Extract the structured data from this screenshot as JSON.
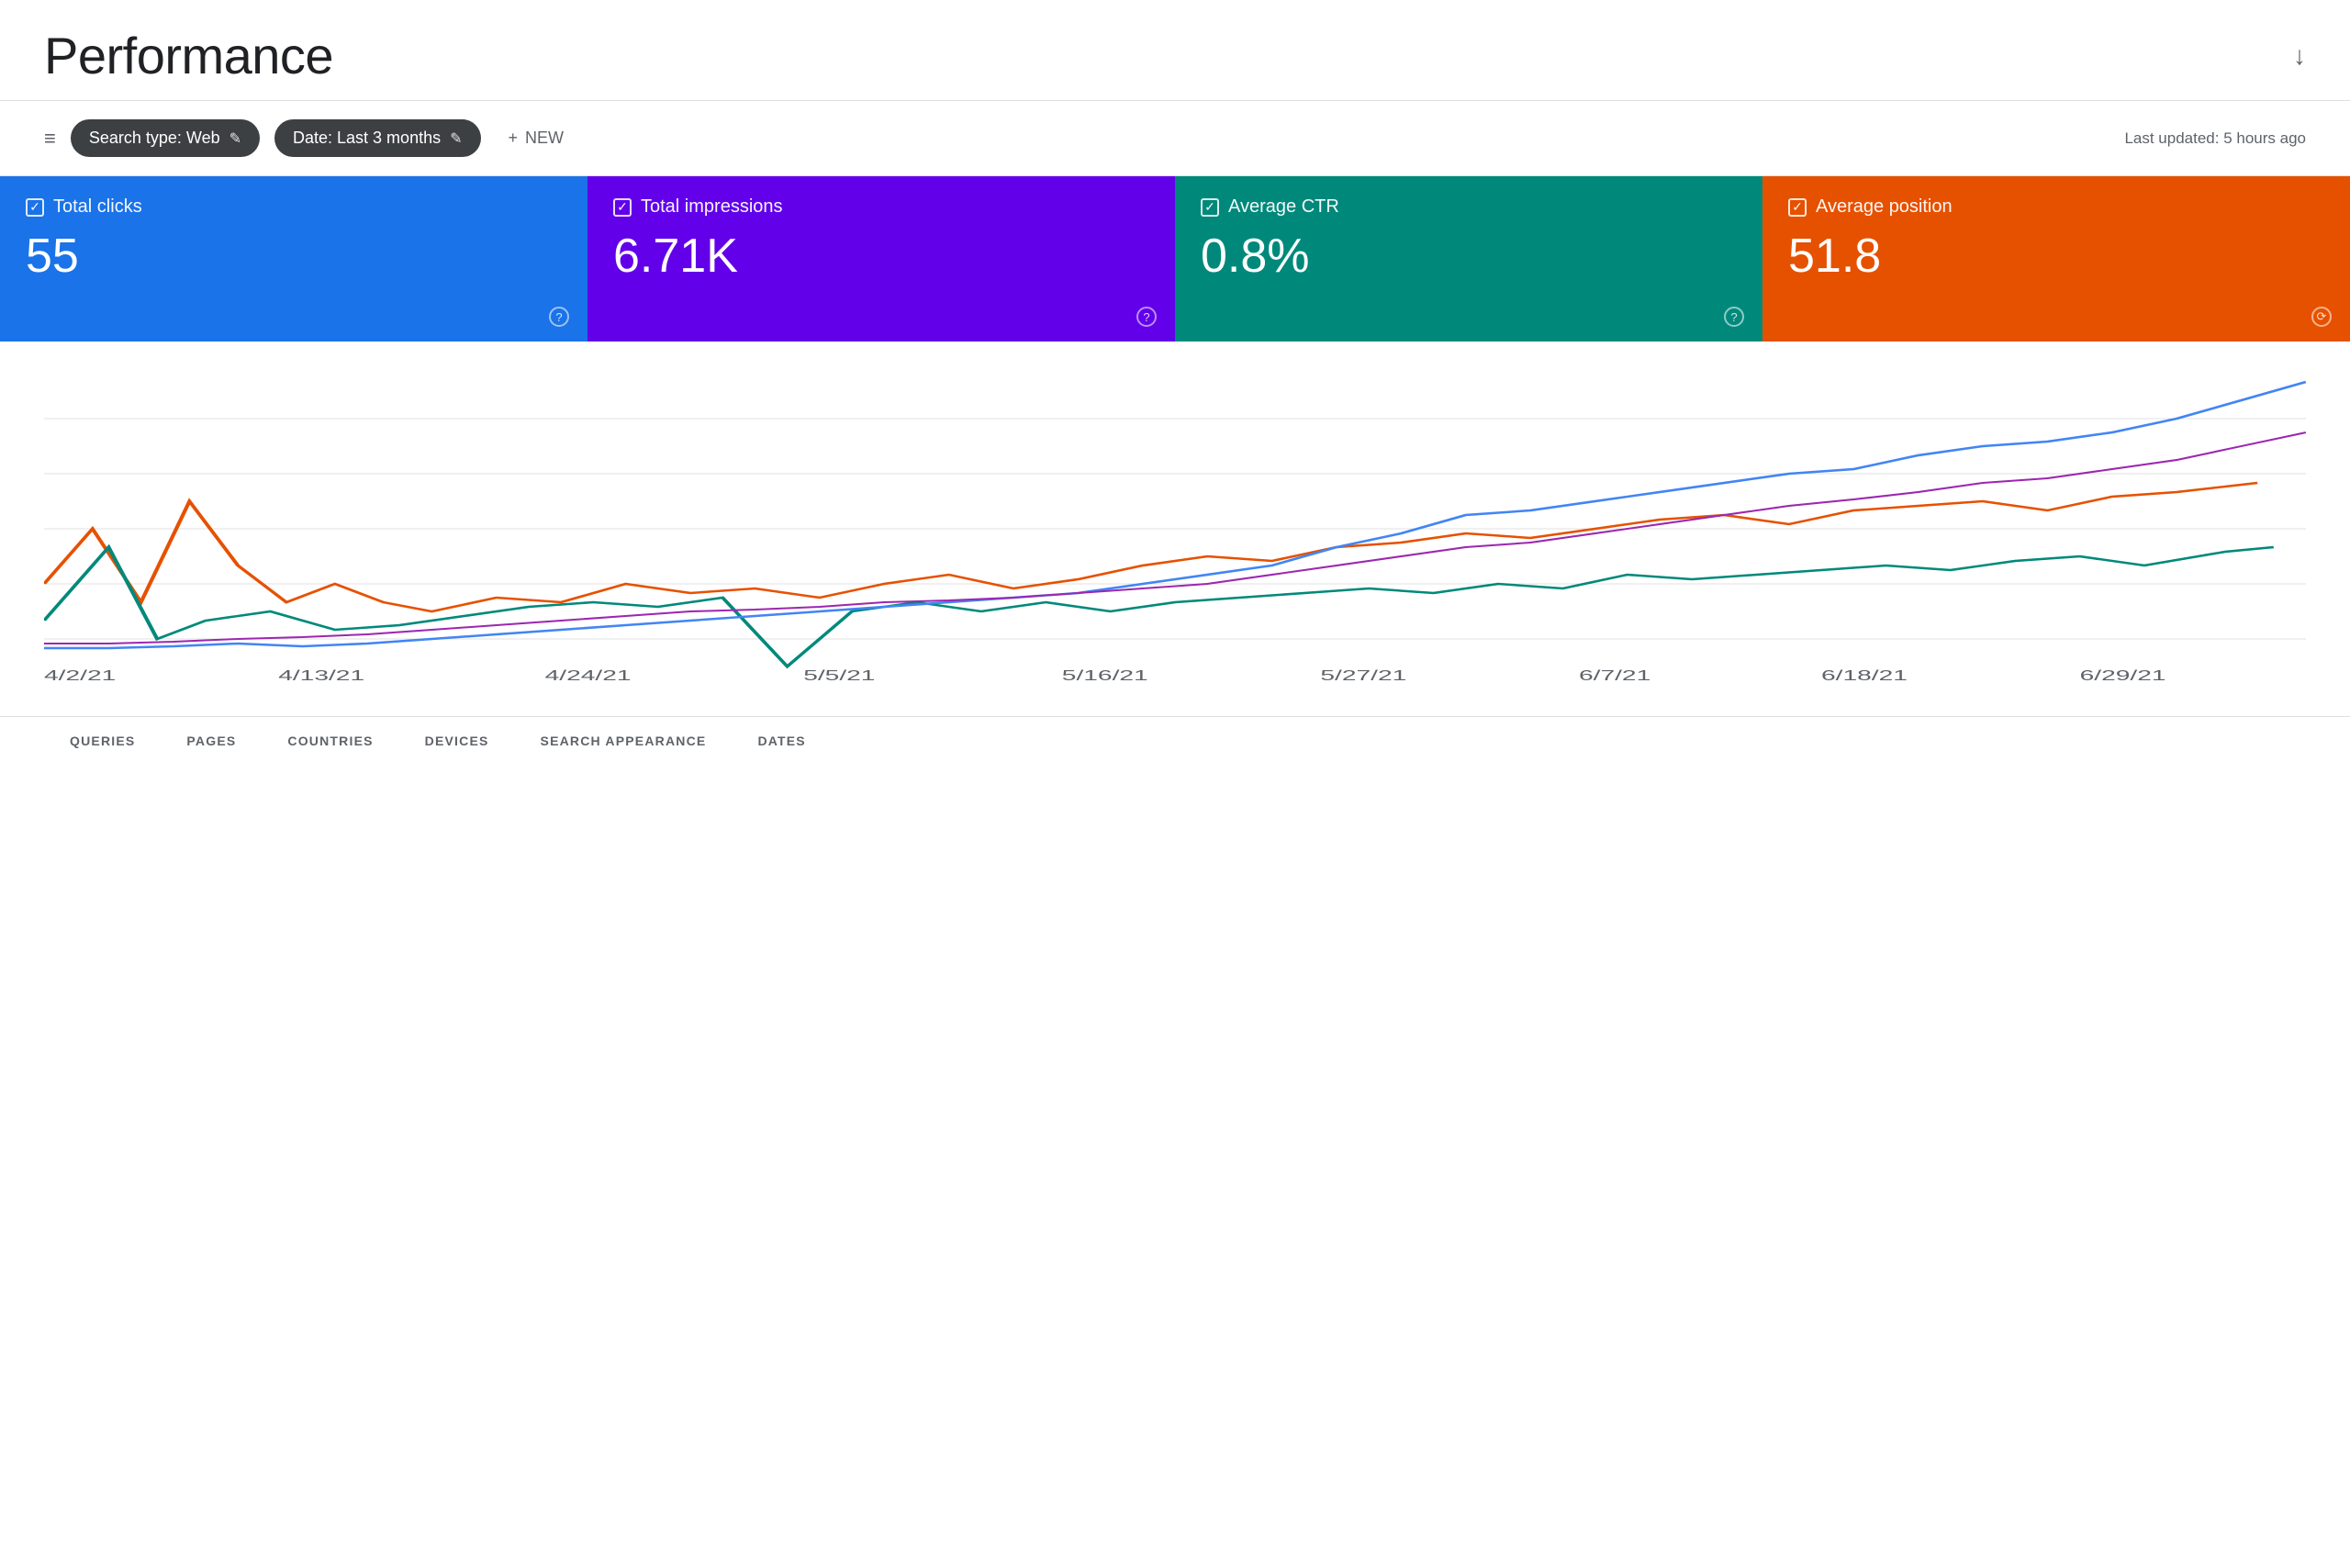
{
  "header": {
    "title": "Performance",
    "last_updated": "Last updated: 5 hours ago"
  },
  "filters": {
    "search_type_label": "Search type: Web",
    "date_label": "Date: Last 3 months",
    "new_label": "NEW",
    "edit_icon": "✎",
    "filter_icon": "≡",
    "plus_icon": "+"
  },
  "metrics": [
    {
      "id": "clicks",
      "label": "Total clicks",
      "value": "55",
      "color": "#1a73e8",
      "checked": true
    },
    {
      "id": "impressions",
      "label": "Total impressions",
      "value": "6.71K",
      "color": "#6200ea",
      "checked": true
    },
    {
      "id": "ctr",
      "label": "Average CTR",
      "value": "0.8%",
      "color": "#00897b",
      "checked": true
    },
    {
      "id": "position",
      "label": "Average position",
      "value": "51.8",
      "color": "#e65100",
      "checked": true
    }
  ],
  "chart": {
    "x_labels": [
      "4/2/21",
      "4/13/21",
      "4/24/21",
      "5/5/21",
      "5/16/21",
      "5/27/21",
      "6/7/21",
      "6/18/21",
      "6/29/21"
    ],
    "lines": [
      {
        "id": "clicks",
        "color": "#1a73e8",
        "label": "Total clicks"
      },
      {
        "id": "impressions",
        "color": "#9c27b0",
        "label": "Total impressions"
      },
      {
        "id": "ctr",
        "color": "#00897b",
        "label": "Average CTR"
      },
      {
        "id": "position",
        "color": "#e65100",
        "label": "Average position"
      }
    ]
  },
  "tabs": {
    "top_tabs": [],
    "bottom_tabs": [
      "QUERIES",
      "PAGES",
      "COUNTRIES",
      "DEVICES",
      "SEARCH APPEARANCE",
      "DATES"
    ]
  },
  "download_icon": "↓"
}
